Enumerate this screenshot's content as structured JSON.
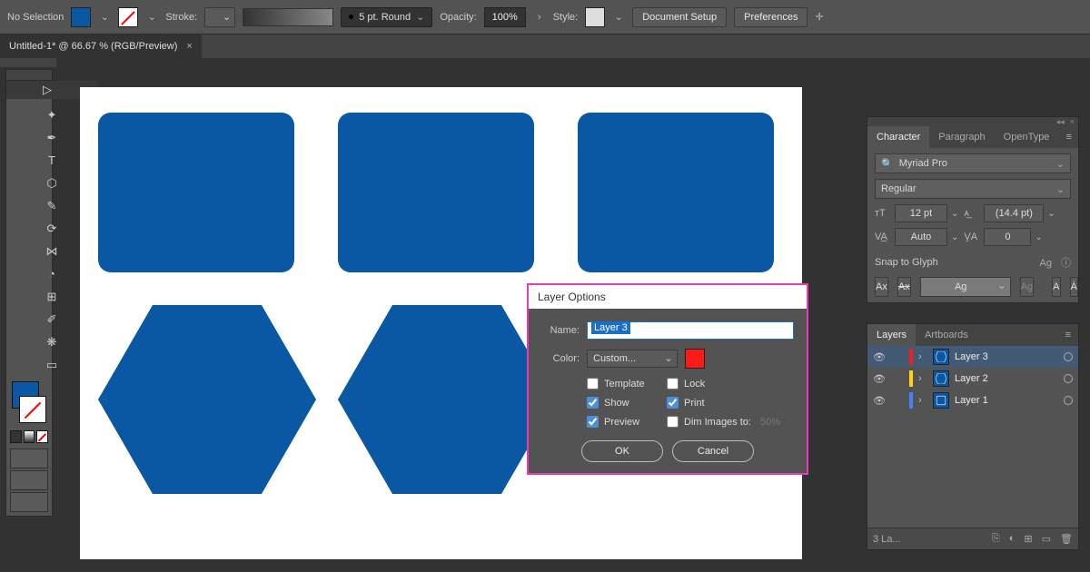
{
  "ctrlbar": {
    "selection": "No Selection",
    "stroke_label": "Stroke:",
    "brush": "5 pt. Round",
    "opacity_label": "Opacity:",
    "opacity_value": "100%",
    "style_label": "Style:",
    "doc_setup": "Document Setup",
    "preferences": "Preferences"
  },
  "doctab": {
    "title": "Untitled-1* @ 66.67 % (RGB/Preview)",
    "close": "×"
  },
  "dialog": {
    "title": "Layer Options",
    "name_label": "Name:",
    "name_value": "Layer 3",
    "color_label": "Color:",
    "color_value": "Custom...",
    "template": "Template",
    "lock": "Lock",
    "show": "Show",
    "print": "Print",
    "preview": "Preview",
    "dim": "Dim Images to:",
    "dim_pct": "50%",
    "ok": "OK",
    "cancel": "Cancel"
  },
  "char": {
    "tabs": [
      "Character",
      "Paragraph",
      "OpenType"
    ],
    "font": "Myriad Pro",
    "style": "Regular",
    "size": "12 pt",
    "leading": "(14.4 pt)",
    "kerning": "Auto",
    "tracking": "0",
    "snap": "Snap to Glyph"
  },
  "layers": {
    "tabs": [
      "Layers",
      "Artboards"
    ],
    "items": [
      {
        "name": "Layer 3",
        "bar": "#ff1a1a"
      },
      {
        "name": "Layer 2",
        "bar": "#ffd21a"
      },
      {
        "name": "Layer 1",
        "bar": "#4a7dff"
      }
    ],
    "count": "3 La..."
  }
}
